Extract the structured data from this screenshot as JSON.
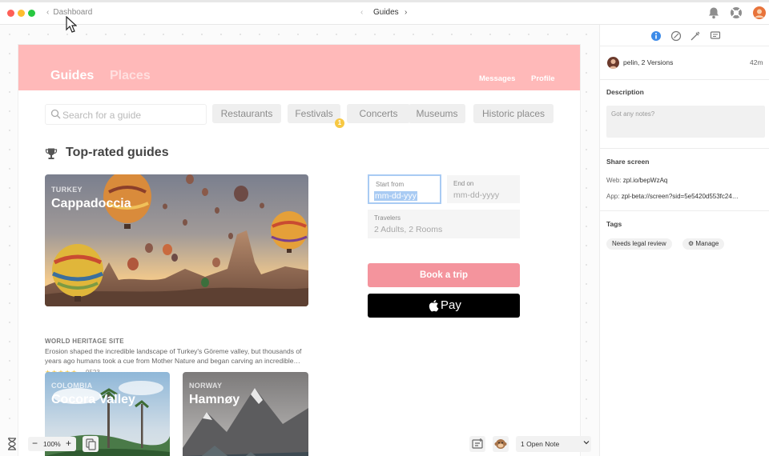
{
  "topbar": {
    "back_label": "Dashboard",
    "back_chevron": "‹",
    "screen_title": "Guides",
    "prev_chevron": "‹",
    "next_chevron": "›",
    "icons": [
      "notification-bell-icon",
      "help-lifebuoy-icon",
      "user-avatar"
    ]
  },
  "artboard": {
    "nav": {
      "guides": "Guides",
      "places": "Places",
      "messages": "Messages",
      "profile": "Profile"
    },
    "search": {
      "placeholder": "Search for a guide"
    },
    "categories": [
      "Restaurants",
      "Festivals",
      "Concerts",
      "Museums",
      "Historic places"
    ],
    "notification_count": "1",
    "section_title": "Top-rated guides",
    "featured": {
      "country": "TURKEY",
      "name": "Cappadoccia",
      "tag": "WORLD HERITAGE SITE",
      "description": "Erosion shaped the incredible landscape of Turkey's Göreme valley, but thousands of years ago humans took a cue from Mother Nature and began carving an incredible…",
      "stars": "★★★★★",
      "rating_count": "9523"
    },
    "cards": [
      {
        "country": "COLOMBIA",
        "name": "Cocora Valley"
      },
      {
        "country": "NORWAY",
        "name": "Hamnøy"
      }
    ],
    "booking": {
      "start_label": "Start from",
      "start_value": "mm-dd-yyy",
      "end_label": "End on",
      "end_value": "mm-dd-yyyy",
      "travelers_label": "Travelers",
      "travelers_value": "2 Adults, 2 Rooms",
      "book_label": "Book a trip",
      "pay_label": "Pay"
    }
  },
  "toolbar": {
    "zoom_minus": "−",
    "zoom": "100%",
    "zoom_plus": "+",
    "notes_select": "1 Open Note"
  },
  "panel": {
    "tabs": [
      "info-icon",
      "edit-note-icon",
      "eyedropper-icon",
      "comment-icon"
    ],
    "version_text": "pelin, 2 Versions",
    "version_time": "42m",
    "description_label": "Description",
    "notes_placeholder": "Got any notes?",
    "share_label": "Share screen",
    "web_label": "Web:",
    "web_url": "zpl.io/bepWzAq",
    "app_label": "App:",
    "app_url": "zpl-beta://screen?sid=5e5420d553fc24…",
    "tags_label": "Tags",
    "tags": [
      "Needs legal review"
    ],
    "manage_label": "Manage"
  },
  "colors": {
    "pink_header": "#ffb9b9",
    "book_button": "#f4949d",
    "info_blue": "#3d8be8",
    "focus_blue": "#a9cbf3",
    "notification_yellow": "#f7c843"
  }
}
